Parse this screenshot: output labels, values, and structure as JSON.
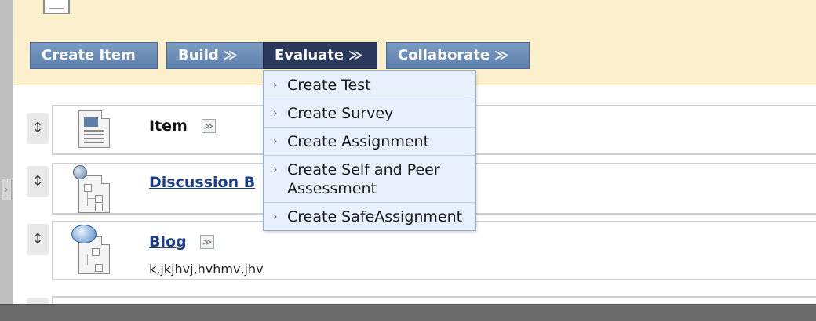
{
  "toolbar": {
    "create_item": "Create Item",
    "build": "Build",
    "evaluate": "Evaluate",
    "collaborate": "Collaborate",
    "chevron": "≫"
  },
  "evaluate_menu": {
    "items": [
      {
        "label": "Create Test"
      },
      {
        "label": "Create Survey"
      },
      {
        "label": "Create Assignment"
      },
      {
        "label": "Create Self and Peer Assessment"
      },
      {
        "label": "Create SafeAssignment"
      }
    ],
    "arrow": "›"
  },
  "content_items": [
    {
      "title": "Item",
      "icon": "document-icon"
    },
    {
      "title": "Discussion B",
      "icon": "discussion-board-icon"
    },
    {
      "title": "Blog",
      "description": "k,jkjhvj,hvhmv,jhv",
      "icon": "blog-icon"
    }
  ],
  "glyphs": {
    "grip": "↕",
    "menu": "≫",
    "side_handle": "›"
  },
  "colors": {
    "header_bg": "#fcf0cc",
    "button": "#6a8bb7",
    "button_active": "#2b3a5c",
    "menu_bg": "#e7f0fb",
    "link": "#1a3d8c"
  }
}
